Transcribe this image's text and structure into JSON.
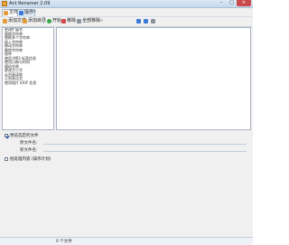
{
  "window": {
    "title": "Ant Renamer 2.09",
    "controls": {
      "minimize": "–",
      "maximize": "□",
      "close": "✕"
    }
  },
  "toolbar_top": {
    "files_label": "文件",
    "actions_label": "操作",
    "more": "»"
  },
  "toolbar_main": {
    "add_files": "添加文件",
    "add_folder": "添加目录",
    "start": "开始",
    "remove": "移除",
    "select_all": "全部移除",
    "more": "»"
  },
  "actions_list": [
    "更改扩展名",
    "替换字符串",
    "替换多个字符串",
    "插入字符串",
    "移动字符串",
    "删除字符串",
    "枚举",
    "使用 MP3 标签信息",
    "使用日期与时间",
    "随机名称",
    "更改大小写",
    "从列表读取",
    "正则表达式",
    "使用相片 EXIF 信息"
  ],
  "options": {
    "show_preview": "预览选定的文件",
    "old_name_label": "原文件名:",
    "new_name_label": "新文件名:",
    "batch_label": "批处理内容 (操作计划)"
  },
  "status": {
    "file_count": "0 个文件"
  }
}
